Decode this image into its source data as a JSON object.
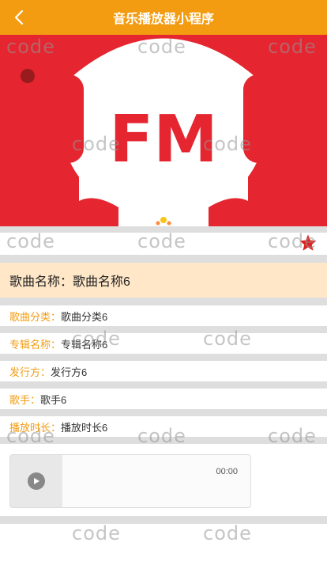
{
  "header": {
    "title": "音乐播放器小程序",
    "back_icon": "chevron-left-icon"
  },
  "banner": {
    "logo_text": "FM"
  },
  "song": {
    "title_label": "歌曲名称：",
    "title_value": "歌曲名称6",
    "favorite_icon": "star-icon",
    "favorite_color": "#e02020"
  },
  "details": [
    {
      "label": "歌曲分类：",
      "value": "歌曲分类6"
    },
    {
      "label": "专辑名称：",
      "value": "专辑名称6"
    },
    {
      "label": "发行方：",
      "value": "发行方6"
    },
    {
      "label": "歌手：",
      "value": "歌手6"
    },
    {
      "label": "播放时长：",
      "value": "播放时长6"
    }
  ],
  "player": {
    "time": "00:00",
    "play_icon": "play-icon"
  },
  "watermark": {
    "text": "code"
  },
  "colors": {
    "accent": "#f39c12",
    "highlight": "#ffe7c8",
    "banner": "#e5252f"
  }
}
